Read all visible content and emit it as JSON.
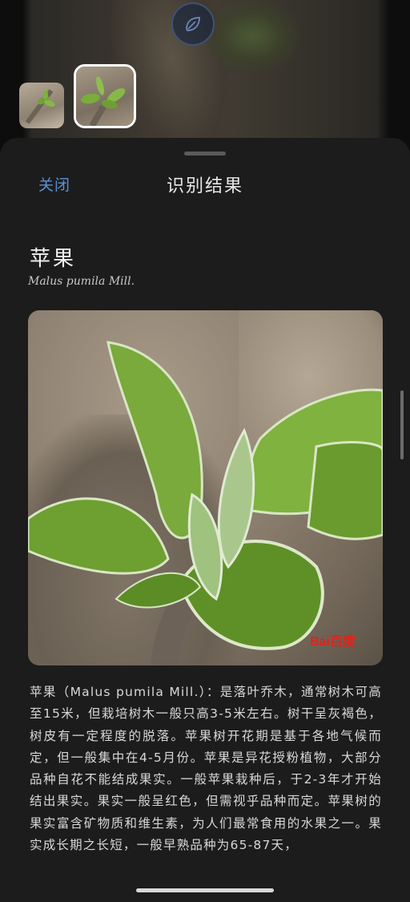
{
  "sheet": {
    "close_label": "关闭",
    "title": "识别结果"
  },
  "result": {
    "name": "苹果",
    "latin_name": "Malus pumila Mill.",
    "description": "苹果（Malus pumila Mill.）：是落叶乔木，通常树木可高至15米，但栽培树木一般只高3-5米左右。树干呈灰褐色，树皮有一定程度的脱落。苹果树开花期是基于各地气候而定，但一般集中在4-5月份。苹果是异花授粉植物，大部分品种自花不能结成果实。一般苹果栽种后，于2-3年才开始结出果实。果实一般呈红色，但需视乎品种而定。苹果树的果实富含矿物质和维生素，为人们最常食用的水果之一。果实成长期之长短，一般早熟品种为65-87天，",
    "watermark": "Bai百度"
  },
  "camera": {
    "shutter_icon": "leaf-scan-icon",
    "thumbnails": [
      "thumbnail-plant-1",
      "thumbnail-plant-2-selected"
    ]
  },
  "colors": {
    "accent": "#5b8fd6",
    "sheet_bg": "#1c1c1c",
    "leaf": "#7fb23a"
  }
}
